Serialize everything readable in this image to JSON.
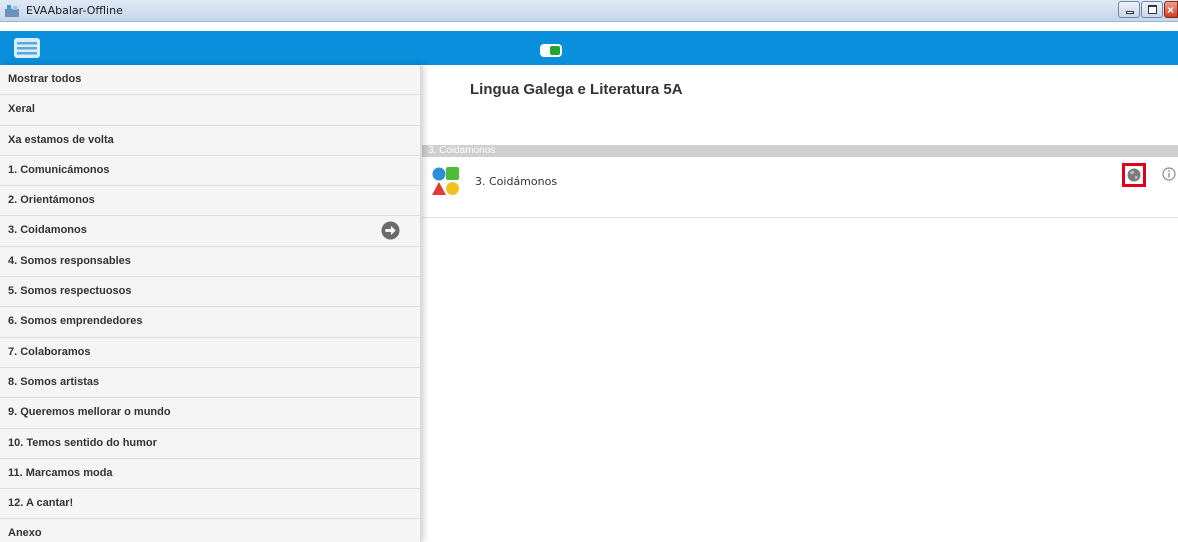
{
  "window": {
    "title": "EVAAbalar-Offline",
    "close_glyph": "×"
  },
  "header": {
    "menu_icon": "menu-list-icon",
    "toggle": {
      "state": "on",
      "color": "#1fa82d"
    },
    "background": "#0a8fdc"
  },
  "sidebar": {
    "items": [
      {
        "label": "Mostrar todos"
      },
      {
        "label": "Xeral"
      },
      {
        "label": "Xa estamos de volta"
      },
      {
        "label": "1. Comunicámonos"
      },
      {
        "label": "2. Orientámonos"
      },
      {
        "label": "3. Coidamonos",
        "selected": true,
        "icon": "arrow-right-circle-icon"
      },
      {
        "label": "4. Somos responsables"
      },
      {
        "label": "5. Somos respectuosos"
      },
      {
        "label": "6. Somos emprendedores"
      },
      {
        "label": "7. Colaboramos"
      },
      {
        "label": "8. Somos artistas"
      },
      {
        "label": "9. Queremos mellorar o mundo"
      },
      {
        "label": "10. Temos sentido do humor"
      },
      {
        "label": "11. Marcamos moda"
      },
      {
        "label": "12. A cantar!"
      },
      {
        "label": "Anexo"
      }
    ]
  },
  "main": {
    "title": "Lingua Galega e Literatura 5A",
    "section_label": "3. Coidamonos",
    "resources": [
      {
        "label": "3. Coidámonos",
        "icon": "shapes-activity-icon",
        "actions": [
          "globe-icon",
          "info-icon"
        ],
        "highlight_color": "#e0001b"
      }
    ]
  }
}
